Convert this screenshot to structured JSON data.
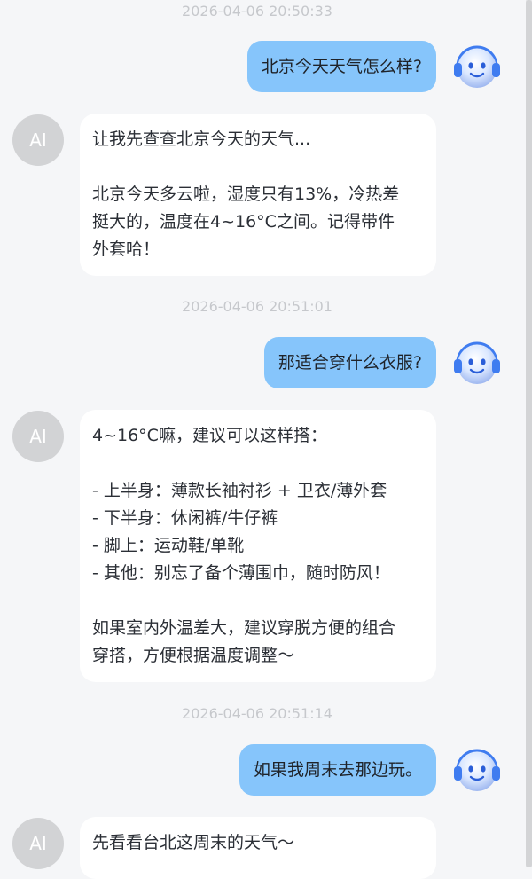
{
  "messages": [
    {
      "type": "timestamp",
      "text": "2026-04-06 20:50:33"
    },
    {
      "type": "user",
      "text": "北京今天天气怎么样?"
    },
    {
      "type": "ai",
      "avatar": "AI",
      "paragraphs": [
        [
          "让我先查查北京今天的天气..."
        ],
        [
          "北京今天多云啦，湿度只有13%，冷热差",
          "挺大的，温度在4~16°C之间。记得带件",
          "外套哈！"
        ]
      ]
    },
    {
      "type": "timestamp",
      "text": "2026-04-06 20:51:01"
    },
    {
      "type": "user",
      "text": "那适合穿什么衣服?"
    },
    {
      "type": "ai",
      "avatar": "AI",
      "paragraphs": [
        [
          "4~16°C嘛，建议可以这样搭："
        ],
        [
          "- 上半身：薄款长袖衬衫 + 卫衣/薄外套",
          "- 下半身：休闲裤/牛仔裤",
          "- 脚上：运动鞋/单靴",
          "- 其他：别忘了备个薄围巾，随时防风！"
        ],
        [
          "如果室内外温差大，建议穿脱方便的组合",
          "穿搭，方便根据温度调整～"
        ]
      ]
    },
    {
      "type": "timestamp",
      "text": "2026-04-06 20:51:14"
    },
    {
      "type": "user",
      "text": "如果我周末去那边玩。"
    },
    {
      "type": "ai",
      "avatar": "AI",
      "paragraphs": [
        [
          "先看看台北这周末的天气～"
        ]
      ]
    }
  ],
  "colors": {
    "user_bubble": "#86c5fb",
    "ai_bubble": "#ffffff",
    "background": "#f5f6f8",
    "timestamp": "#c6c8cc",
    "ai_avatar": "#d2d3d5"
  },
  "icons": {
    "user_avatar": "robot-headphones-icon"
  }
}
